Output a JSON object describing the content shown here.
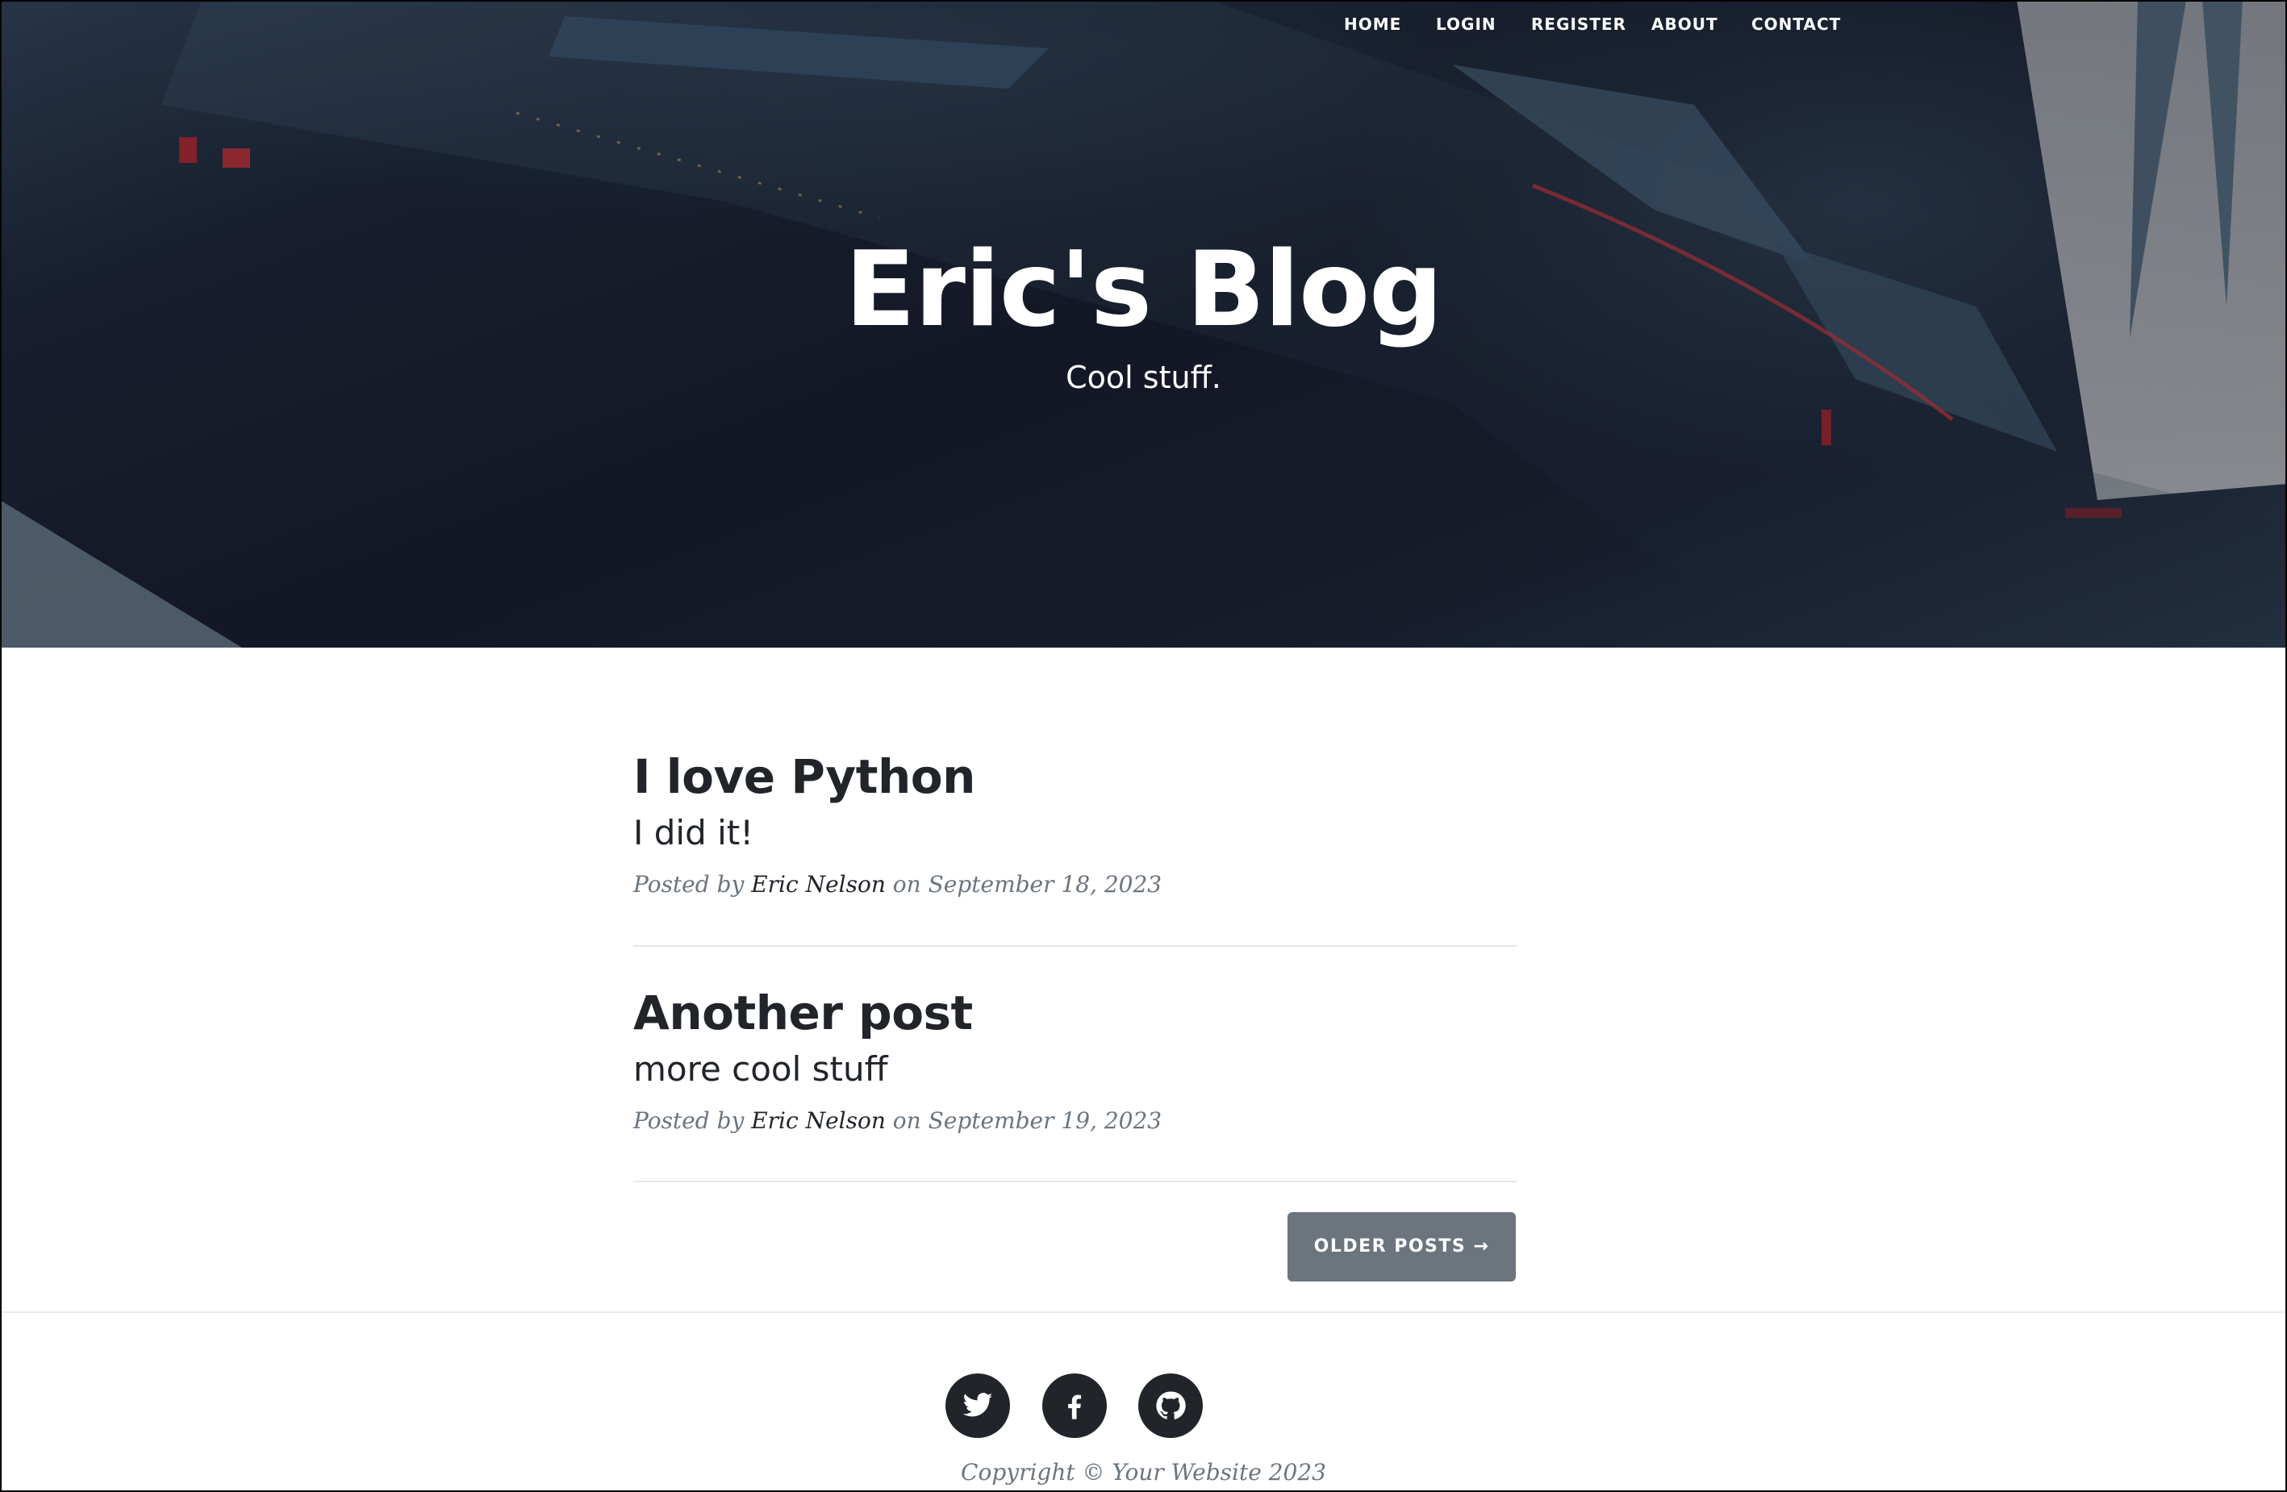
{
  "nav": {
    "home": "HOME",
    "login": "LOGIN",
    "register": "REGISTER",
    "about": "ABOUT",
    "contact": "CONTACT"
  },
  "header": {
    "title": "Eric's Blog",
    "subtitle": "Cool stuff."
  },
  "posts": [
    {
      "title": "I love Python",
      "subtitle": "I did it!",
      "meta_prefix": "Posted by",
      "author": "Eric Nelson",
      "meta_suffix": "on September 18, 2023"
    },
    {
      "title": "Another post",
      "subtitle": "more cool stuff",
      "meta_prefix": "Posted by",
      "author": "Eric Nelson",
      "meta_suffix": "on September 19, 2023"
    }
  ],
  "pager": {
    "older_label": "OLDER POSTS →"
  },
  "footer": {
    "social": [
      {
        "name": "twitter-icon"
      },
      {
        "name": "facebook-icon"
      },
      {
        "name": "github-icon"
      }
    ],
    "copyright": "Copyright © Your Website 2023"
  },
  "colors": {
    "text": "#212529",
    "muted": "#6c757d",
    "button": "#6c757d",
    "divider": "#e6e7e9",
    "hero_dark": "#171b29"
  }
}
